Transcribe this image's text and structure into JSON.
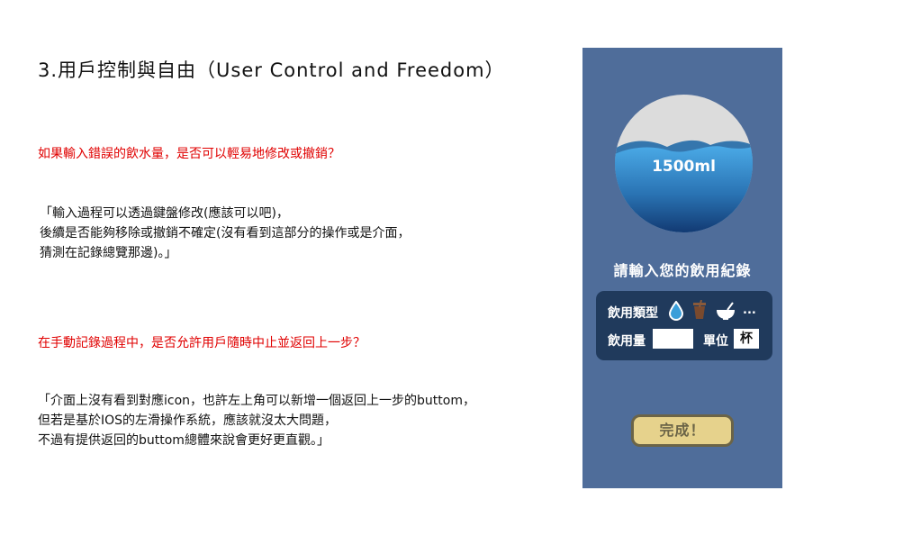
{
  "slide": {
    "title": "3.用戶控制與自由（User Control and Freedom）",
    "question1": "如果輸入錯誤的飲水量，是否可以輕易地修改或撤銷？",
    "answer1": [
      "「輸入過程可以透過鍵盤修改(應該可以吧)，",
      "後續是否能夠移除或撤銷不確定(沒有看到這部分的操作或是介面，",
      "猜測在記錄總覽那邊)。」"
    ],
    "question2": "在手動記錄過程中，是否允許用戶隨時中止並返回上一步？",
    "answer2": [
      "「介面上沒有看到對應icon，也許左上角可以新增一個返回上一步的buttom，",
      "但若是基於IOS的左滑操作系統，應該就沒太大問題，",
      "不過有提供返回的buttom總體來說會更好更直觀。」"
    ]
  },
  "phone": {
    "amount": "1500ml",
    "prompt": "請輸入您的飲用紀錄",
    "drink_type_label": "飲用類型",
    "drink_type_icons": [
      "water-drop-icon",
      "cup-icon",
      "bowl-icon"
    ],
    "more_label": "...",
    "volume_label": "飲用量",
    "volume_value": "",
    "unit_label": "單位",
    "unit_value": "杯",
    "done_label": "完成！"
  },
  "colors": {
    "phone_bg": "#4f6d9a",
    "panel_bg": "#203a5c",
    "water": "#3b9ed9",
    "question_red": "#e00000",
    "button_bg": "#e6d28c",
    "button_border": "#6b6447"
  }
}
